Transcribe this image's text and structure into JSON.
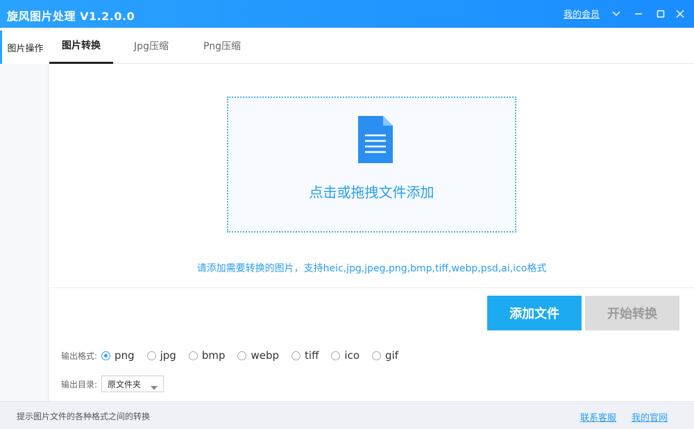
{
  "window": {
    "title": "旋风图片处理 V1.2.0.0",
    "member_link": "我的会员"
  },
  "sidebar": {
    "items": [
      {
        "label": "图片操作",
        "active": true
      }
    ]
  },
  "tabs": [
    {
      "label": "图片转换",
      "active": true
    },
    {
      "label": "Jpg压缩",
      "active": false
    },
    {
      "label": "Png压缩",
      "active": false
    }
  ],
  "dropzone": {
    "icon": "document-icon",
    "text": "点击或拖拽文件添加"
  },
  "hint": "请添加需要转换的图片，支持heic,jpg,jpeg,png,bmp,tiff,webp,psd,ai,ico格式",
  "buttons": {
    "add_files": "添加文件",
    "start_convert": "开始转换"
  },
  "output_format": {
    "label": "输出格式:",
    "selected": "png",
    "options": [
      "png",
      "jpg",
      "bmp",
      "webp",
      "tiff",
      "ico",
      "gif"
    ]
  },
  "output_dir": {
    "label": "输出目录:",
    "value": "原文件夹"
  },
  "footer": {
    "text": "提示图片文件的各种格式之间的转换",
    "links": [
      "联系客服",
      "我的官网"
    ]
  },
  "colors": {
    "accent": "#1eaaf0",
    "titlebar": "#2aa2ff",
    "link": "#2a9df0",
    "disabled_button": "#dcdcdc"
  }
}
